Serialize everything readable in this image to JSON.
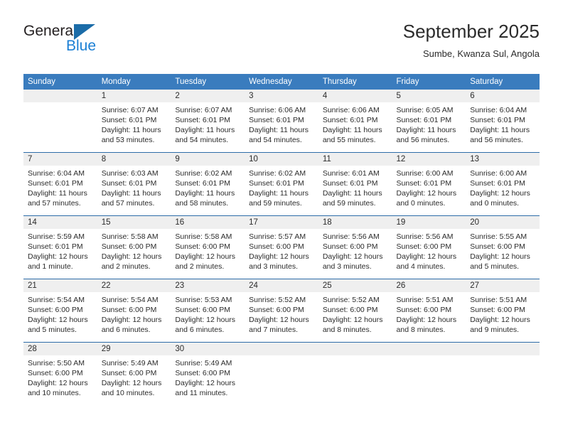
{
  "logo": {
    "word1": "General",
    "word2": "Blue",
    "triangle_color": "#1b6ca8",
    "blue_text_color": "#1b7fd4"
  },
  "header": {
    "title": "September 2025",
    "subtitle": "Sumbe, Kwanza Sul, Angola"
  },
  "colors": {
    "header_row_bg": "#3a7cbe",
    "header_row_text": "#ffffff",
    "daynum_band_bg": "#efefef",
    "week_separator": "#2d6ca8"
  },
  "weekdays": [
    "Sunday",
    "Monday",
    "Tuesday",
    "Wednesday",
    "Thursday",
    "Friday",
    "Saturday"
  ],
  "weeks": [
    [
      {
        "day": "",
        "blank": true,
        "sunrise": "",
        "sunset": "",
        "daylight_line1": "",
        "daylight_line2": ""
      },
      {
        "day": "1",
        "blank": false,
        "sunrise": "Sunrise: 6:07 AM",
        "sunset": "Sunset: 6:01 PM",
        "daylight_line1": "Daylight: 11 hours",
        "daylight_line2": "and 53 minutes."
      },
      {
        "day": "2",
        "blank": false,
        "sunrise": "Sunrise: 6:07 AM",
        "sunset": "Sunset: 6:01 PM",
        "daylight_line1": "Daylight: 11 hours",
        "daylight_line2": "and 54 minutes."
      },
      {
        "day": "3",
        "blank": false,
        "sunrise": "Sunrise: 6:06 AM",
        "sunset": "Sunset: 6:01 PM",
        "daylight_line1": "Daylight: 11 hours",
        "daylight_line2": "and 54 minutes."
      },
      {
        "day": "4",
        "blank": false,
        "sunrise": "Sunrise: 6:06 AM",
        "sunset": "Sunset: 6:01 PM",
        "daylight_line1": "Daylight: 11 hours",
        "daylight_line2": "and 55 minutes."
      },
      {
        "day": "5",
        "blank": false,
        "sunrise": "Sunrise: 6:05 AM",
        "sunset": "Sunset: 6:01 PM",
        "daylight_line1": "Daylight: 11 hours",
        "daylight_line2": "and 56 minutes."
      },
      {
        "day": "6",
        "blank": false,
        "sunrise": "Sunrise: 6:04 AM",
        "sunset": "Sunset: 6:01 PM",
        "daylight_line1": "Daylight: 11 hours",
        "daylight_line2": "and 56 minutes."
      }
    ],
    [
      {
        "day": "7",
        "blank": false,
        "sunrise": "Sunrise: 6:04 AM",
        "sunset": "Sunset: 6:01 PM",
        "daylight_line1": "Daylight: 11 hours",
        "daylight_line2": "and 57 minutes."
      },
      {
        "day": "8",
        "blank": false,
        "sunrise": "Sunrise: 6:03 AM",
        "sunset": "Sunset: 6:01 PM",
        "daylight_line1": "Daylight: 11 hours",
        "daylight_line2": "and 57 minutes."
      },
      {
        "day": "9",
        "blank": false,
        "sunrise": "Sunrise: 6:02 AM",
        "sunset": "Sunset: 6:01 PM",
        "daylight_line1": "Daylight: 11 hours",
        "daylight_line2": "and 58 minutes."
      },
      {
        "day": "10",
        "blank": false,
        "sunrise": "Sunrise: 6:02 AM",
        "sunset": "Sunset: 6:01 PM",
        "daylight_line1": "Daylight: 11 hours",
        "daylight_line2": "and 59 minutes."
      },
      {
        "day": "11",
        "blank": false,
        "sunrise": "Sunrise: 6:01 AM",
        "sunset": "Sunset: 6:01 PM",
        "daylight_line1": "Daylight: 11 hours",
        "daylight_line2": "and 59 minutes."
      },
      {
        "day": "12",
        "blank": false,
        "sunrise": "Sunrise: 6:00 AM",
        "sunset": "Sunset: 6:01 PM",
        "daylight_line1": "Daylight: 12 hours",
        "daylight_line2": "and 0 minutes."
      },
      {
        "day": "13",
        "blank": false,
        "sunrise": "Sunrise: 6:00 AM",
        "sunset": "Sunset: 6:01 PM",
        "daylight_line1": "Daylight: 12 hours",
        "daylight_line2": "and 0 minutes."
      }
    ],
    [
      {
        "day": "14",
        "blank": false,
        "sunrise": "Sunrise: 5:59 AM",
        "sunset": "Sunset: 6:01 PM",
        "daylight_line1": "Daylight: 12 hours",
        "daylight_line2": "and 1 minute."
      },
      {
        "day": "15",
        "blank": false,
        "sunrise": "Sunrise: 5:58 AM",
        "sunset": "Sunset: 6:00 PM",
        "daylight_line1": "Daylight: 12 hours",
        "daylight_line2": "and 2 minutes."
      },
      {
        "day": "16",
        "blank": false,
        "sunrise": "Sunrise: 5:58 AM",
        "sunset": "Sunset: 6:00 PM",
        "daylight_line1": "Daylight: 12 hours",
        "daylight_line2": "and 2 minutes."
      },
      {
        "day": "17",
        "blank": false,
        "sunrise": "Sunrise: 5:57 AM",
        "sunset": "Sunset: 6:00 PM",
        "daylight_line1": "Daylight: 12 hours",
        "daylight_line2": "and 3 minutes."
      },
      {
        "day": "18",
        "blank": false,
        "sunrise": "Sunrise: 5:56 AM",
        "sunset": "Sunset: 6:00 PM",
        "daylight_line1": "Daylight: 12 hours",
        "daylight_line2": "and 3 minutes."
      },
      {
        "day": "19",
        "blank": false,
        "sunrise": "Sunrise: 5:56 AM",
        "sunset": "Sunset: 6:00 PM",
        "daylight_line1": "Daylight: 12 hours",
        "daylight_line2": "and 4 minutes."
      },
      {
        "day": "20",
        "blank": false,
        "sunrise": "Sunrise: 5:55 AM",
        "sunset": "Sunset: 6:00 PM",
        "daylight_line1": "Daylight: 12 hours",
        "daylight_line2": "and 5 minutes."
      }
    ],
    [
      {
        "day": "21",
        "blank": false,
        "sunrise": "Sunrise: 5:54 AM",
        "sunset": "Sunset: 6:00 PM",
        "daylight_line1": "Daylight: 12 hours",
        "daylight_line2": "and 5 minutes."
      },
      {
        "day": "22",
        "blank": false,
        "sunrise": "Sunrise: 5:54 AM",
        "sunset": "Sunset: 6:00 PM",
        "daylight_line1": "Daylight: 12 hours",
        "daylight_line2": "and 6 minutes."
      },
      {
        "day": "23",
        "blank": false,
        "sunrise": "Sunrise: 5:53 AM",
        "sunset": "Sunset: 6:00 PM",
        "daylight_line1": "Daylight: 12 hours",
        "daylight_line2": "and 6 minutes."
      },
      {
        "day": "24",
        "blank": false,
        "sunrise": "Sunrise: 5:52 AM",
        "sunset": "Sunset: 6:00 PM",
        "daylight_line1": "Daylight: 12 hours",
        "daylight_line2": "and 7 minutes."
      },
      {
        "day": "25",
        "blank": false,
        "sunrise": "Sunrise: 5:52 AM",
        "sunset": "Sunset: 6:00 PM",
        "daylight_line1": "Daylight: 12 hours",
        "daylight_line2": "and 8 minutes."
      },
      {
        "day": "26",
        "blank": false,
        "sunrise": "Sunrise: 5:51 AM",
        "sunset": "Sunset: 6:00 PM",
        "daylight_line1": "Daylight: 12 hours",
        "daylight_line2": "and 8 minutes."
      },
      {
        "day": "27",
        "blank": false,
        "sunrise": "Sunrise: 5:51 AM",
        "sunset": "Sunset: 6:00 PM",
        "daylight_line1": "Daylight: 12 hours",
        "daylight_line2": "and 9 minutes."
      }
    ],
    [
      {
        "day": "28",
        "blank": false,
        "sunrise": "Sunrise: 5:50 AM",
        "sunset": "Sunset: 6:00 PM",
        "daylight_line1": "Daylight: 12 hours",
        "daylight_line2": "and 10 minutes."
      },
      {
        "day": "29",
        "blank": false,
        "sunrise": "Sunrise: 5:49 AM",
        "sunset": "Sunset: 6:00 PM",
        "daylight_line1": "Daylight: 12 hours",
        "daylight_line2": "and 10 minutes."
      },
      {
        "day": "30",
        "blank": false,
        "sunrise": "Sunrise: 5:49 AM",
        "sunset": "Sunset: 6:00 PM",
        "daylight_line1": "Daylight: 12 hours",
        "daylight_line2": "and 11 minutes."
      },
      {
        "day": "",
        "blank": true,
        "sunrise": "",
        "sunset": "",
        "daylight_line1": "",
        "daylight_line2": ""
      },
      {
        "day": "",
        "blank": true,
        "sunrise": "",
        "sunset": "",
        "daylight_line1": "",
        "daylight_line2": ""
      },
      {
        "day": "",
        "blank": true,
        "sunrise": "",
        "sunset": "",
        "daylight_line1": "",
        "daylight_line2": ""
      },
      {
        "day": "",
        "blank": true,
        "sunrise": "",
        "sunset": "",
        "daylight_line1": "",
        "daylight_line2": ""
      }
    ]
  ]
}
